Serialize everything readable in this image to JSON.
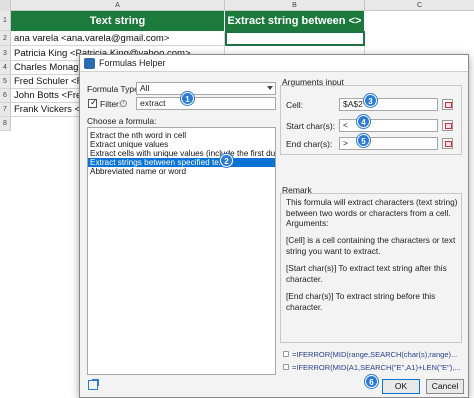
{
  "sheet": {
    "columns": [
      "A",
      "B",
      "C"
    ],
    "row_numbers": [
      "1",
      "2",
      "3",
      "4",
      "5",
      "6",
      "7",
      "8"
    ],
    "header_a": "Text string",
    "header_b": "Extract string between <>",
    "rows": [
      "ana varela <ana.varela@gmail.com>",
      "Patricia King <Patricia.King@yahoo.com>",
      "Charles Monaghan",
      "Fred Schuler <Fred",
      "John Botts <Fred.S",
      "Frank Vickers <Fred"
    ],
    "header_color": "#1d7a3d"
  },
  "dialog": {
    "title": "Formulas Helper",
    "formula_type_label": "Formula Type:",
    "formula_type_value": "All",
    "filter_label": "Filter:",
    "filter_checked": true,
    "filter_value": "extract",
    "choose_label": "Choose a formula:",
    "formulas": [
      "Extract the nth word in cell",
      "Extract unique values",
      "Extract cells with unique values (include the first duplicate)",
      "Extract strings between specified text",
      "Abbreviated name or word"
    ],
    "selected_formula_index": 3,
    "arguments": {
      "title": "Arguments input",
      "cell_label": "Cell:",
      "cell_value": "$A$2",
      "start_label": "Start char(s):",
      "start_value": "<",
      "end_label": "End char(s):",
      "end_value": ">"
    },
    "remark": {
      "title": "Remark",
      "p1": "This formula will extract characters (text string) between two words or characters from a cell. Arguments:",
      "p2": "[Cell] is a cell containing the characters or text string you want to extract.",
      "p3": "[Start char(s)] To extract text string after this character.",
      "p4": "[End char(s)] To extract string before this character."
    },
    "formula_preview_1": "=IFERROR(MID(range,SEARCH(char(s),range)...",
    "formula_preview_2": "=IFERROR(MID(A1,SEARCH(\"E\",A1)+LEN(\"E\"),...",
    "ok_label": "OK",
    "cancel_label": "Cancel",
    "accent_color": "#0a74d6"
  },
  "badges": [
    "1",
    "2",
    "3",
    "4",
    "5",
    "6"
  ]
}
